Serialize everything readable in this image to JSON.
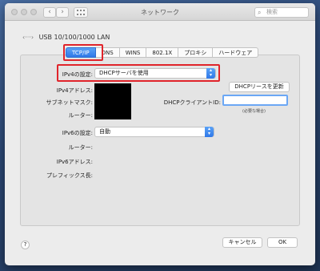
{
  "window": {
    "title": "ネットワーク",
    "search_placeholder": "検索"
  },
  "interface": {
    "name": "USB 10/100/1000 LAN"
  },
  "tabs": [
    {
      "label": "TCP/IP",
      "active": true
    },
    {
      "label": "DNS"
    },
    {
      "label": "WINS"
    },
    {
      "label": "802.1X"
    },
    {
      "label": "プロキシ"
    },
    {
      "label": "ハードウェア"
    }
  ],
  "ipv4": {
    "config_label": "IPv4の設定:",
    "config_value": "DHCPサーバを使用",
    "address_label": "IPv4アドレス:",
    "subnet_label": "サブネットマスク:",
    "router_label": "ルーター:",
    "renew_button": "DHCPリースを更新",
    "client_id_label": "DHCPクライアントID:",
    "client_id_note": "(必要な場合)"
  },
  "ipv6": {
    "config_label": "IPv6の設定:",
    "config_value": "自動",
    "router_label": "ルーター:",
    "address_label": "IPv6アドレス:",
    "prefix_label": "プレフィックス長:"
  },
  "footer": {
    "help": "?",
    "cancel": "キャンセル",
    "ok": "OK"
  }
}
